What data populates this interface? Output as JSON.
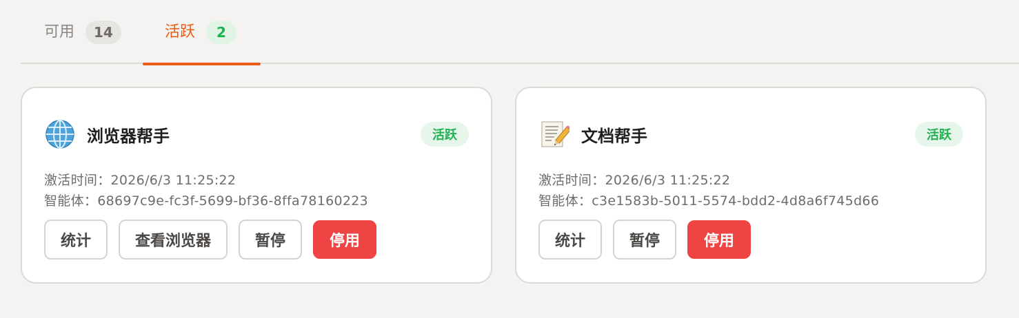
{
  "tabs": [
    {
      "label": "可用",
      "count": "14"
    },
    {
      "label": "活跃",
      "count": "2"
    }
  ],
  "agents": [
    {
      "icon": "globe-icon",
      "name": "浏览器帮手",
      "status": "活跃",
      "activated_label": "激活时间：",
      "activated_at": "2026/6/3 11:25:22",
      "agent_label": "智能体：",
      "agent_id": "68697c9e-fc3f-5699-bf36-8ffa78160223",
      "actions": {
        "stats": "统计",
        "view_browser": "查看浏览器",
        "pause": "暂停",
        "disable": "停用"
      }
    },
    {
      "icon": "memo-icon",
      "name": "文档帮手",
      "status": "活跃",
      "activated_label": "激活时间：",
      "activated_at": "2026/6/3 11:25:22",
      "agent_label": "智能体：",
      "agent_id": "c3e1583b-5011-5574-bdd2-4d8a6f745d66",
      "actions": {
        "stats": "统计",
        "pause": "暂停",
        "disable": "停用"
      }
    }
  ],
  "colors": {
    "accent": "#ee5b12",
    "success": "#21b153",
    "danger": "#ef4444"
  }
}
